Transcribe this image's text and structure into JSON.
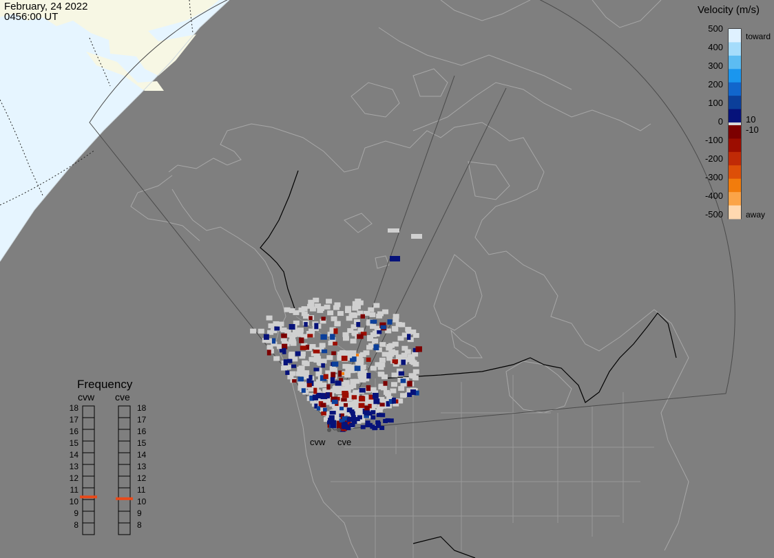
{
  "header": {
    "date": "February, 24 2022",
    "time": "0456:00 UT"
  },
  "radars": [
    {
      "id": "cvw",
      "label": "cvw"
    },
    {
      "id": "cve",
      "label": "cve"
    }
  ],
  "velocity_scale": {
    "title": "Velocity (m/s)",
    "ticks": [
      "500",
      "400",
      "300",
      "200",
      "100",
      "0",
      "-100",
      "-200",
      "-300",
      "-400",
      "-500"
    ],
    "tick_values": [
      500,
      400,
      300,
      200,
      100,
      0,
      -100,
      -200,
      -300,
      -400,
      -500
    ],
    "thresholds": [
      "10",
      "-10"
    ],
    "toward_label": "toward",
    "away_label": "away",
    "colors": {
      "toward": [
        "#dff1ff",
        "#a5dcfb",
        "#5cbcf2",
        "#1a96ee",
        "#1166cc",
        "#0b3f9a",
        "#06127a"
      ],
      "zero": "#d8d8d8",
      "away": [
        "#7c0000",
        "#9c0d00",
        "#c02a06",
        "#dd4f08",
        "#f27c0c",
        "#fba448",
        "#ffd8b0"
      ]
    }
  },
  "frequency": {
    "title": "Frequency",
    "columns": [
      "cvw",
      "cve"
    ],
    "levels": [
      "18",
      "17",
      "16",
      "15",
      "14",
      "13",
      "12",
      "11",
      "10",
      "9",
      "8"
    ],
    "selected": {
      "cvw": 10.75,
      "cve": 10.6
    },
    "marker_color": "#e84a1a"
  },
  "map_colors": {
    "background": "#7f7f7f",
    "daylight": "#e6f5ff",
    "ground": "#f7f7e4",
    "coastline": "#a8a8a8",
    "fov": "#4a4a4a",
    "no_data_cell": "#d0d0d0"
  }
}
